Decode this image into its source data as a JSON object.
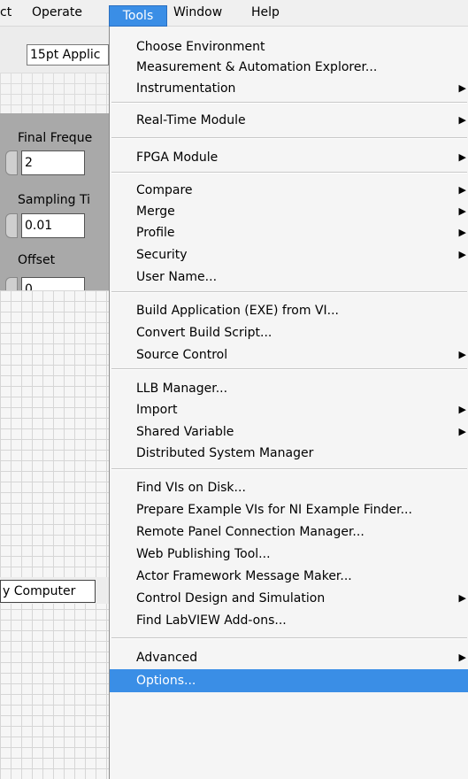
{
  "menubar": {
    "project": "ct",
    "operate": "Operate",
    "tools": "Tools",
    "window": "Window",
    "help": "Help"
  },
  "left_panel": {
    "font_selector": "15pt Applic",
    "controls": [
      {
        "label": "Final Freque",
        "value": "2"
      },
      {
        "label": "Sampling Ti",
        "value": "0.01"
      },
      {
        "label": "Offset",
        "value": "0"
      }
    ],
    "target": "y Computer"
  },
  "tools_menu": {
    "items": [
      {
        "label": "Choose Environment",
        "submenu": false
      },
      {
        "label": "Measurement & Automation Explorer...",
        "submenu": false
      },
      {
        "label": "Instrumentation",
        "submenu": true
      },
      {
        "label": "Real-Time Module",
        "submenu": true
      },
      {
        "label": "FPGA Module",
        "submenu": true
      },
      {
        "label": "Compare",
        "submenu": true
      },
      {
        "label": "Merge",
        "submenu": true
      },
      {
        "label": "Profile",
        "submenu": true
      },
      {
        "label": "Security",
        "submenu": true
      },
      {
        "label": "User Name...",
        "submenu": false
      },
      {
        "label": "Build Application (EXE) from VI...",
        "submenu": false
      },
      {
        "label": "Convert Build Script...",
        "submenu": false
      },
      {
        "label": "Source Control",
        "submenu": true
      },
      {
        "label": "LLB Manager...",
        "submenu": false
      },
      {
        "label": "Import",
        "submenu": true
      },
      {
        "label": "Shared Variable",
        "submenu": true
      },
      {
        "label": "Distributed System Manager",
        "submenu": false
      },
      {
        "label": "Find VIs on Disk...",
        "submenu": false
      },
      {
        "label": "Prepare Example VIs for NI Example Finder...",
        "submenu": false
      },
      {
        "label": "Remote Panel Connection Manager...",
        "submenu": false
      },
      {
        "label": "Web Publishing Tool...",
        "submenu": false
      },
      {
        "label": "Actor Framework Message Maker...",
        "submenu": false
      },
      {
        "label": "Control Design and Simulation",
        "submenu": true
      },
      {
        "label": "Find LabVIEW Add-ons...",
        "submenu": false
      },
      {
        "label": "Advanced",
        "submenu": true
      },
      {
        "label": "Options...",
        "submenu": false,
        "highlighted": true
      }
    ],
    "arrow_glyph": "▶"
  },
  "colors": {
    "highlight": "#3a8ee6",
    "menu_bg": "#f5f5f5"
  }
}
